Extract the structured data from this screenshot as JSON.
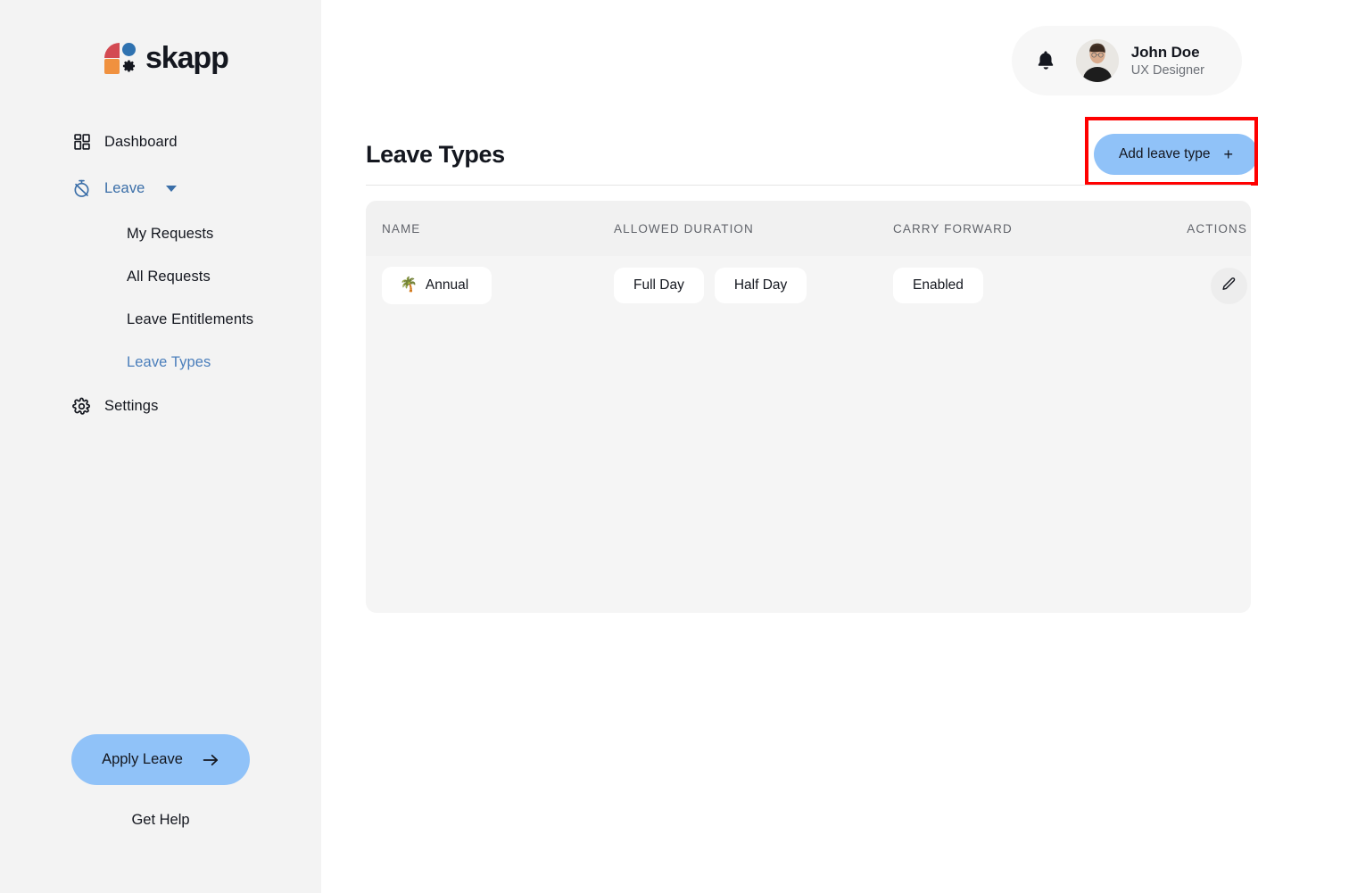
{
  "brand": {
    "name": "skapp",
    "logo_colors": {
      "red": "#d34a52",
      "orange": "#f0913f",
      "blue": "#2f72b0",
      "gear": "#14171f"
    }
  },
  "theme": {
    "accent_blue": "#90c2f8",
    "active_nav_blue": "#4a7ebb",
    "sidebar_bg": "#f3f3f3",
    "table_bg": "#f5f5f5",
    "table_header_bg": "#f1f1f1",
    "highlight_red": "#ff0000"
  },
  "sidebar": {
    "items": [
      {
        "label": "Dashboard",
        "icon": "grid-icon",
        "active": false
      },
      {
        "label": "Leave",
        "icon": "stopwatch-off-icon",
        "active": true,
        "expanded": true
      },
      {
        "label": "Settings",
        "icon": "gear-icon",
        "active": false
      }
    ],
    "leave_subitems": [
      {
        "label": "My Requests",
        "active": false
      },
      {
        "label": "All Requests",
        "active": false
      },
      {
        "label": "Leave Entitlements",
        "active": false
      },
      {
        "label": "Leave Types",
        "active": true
      }
    ],
    "apply_leave_label": "Apply Leave",
    "get_help_label": "Get Help"
  },
  "header": {
    "notification_icon": "bell-icon",
    "user": {
      "name": "John Doe",
      "role": "UX Designer",
      "avatar_alt": "avatar"
    }
  },
  "main": {
    "page_title": "Leave Types",
    "add_button_label": "Add leave type",
    "add_button_glyph": "+"
  },
  "table": {
    "columns": [
      "NAME",
      "ALLOWED DURATION",
      "CARRY FORWARD",
      "ACTIONS"
    ],
    "rows": [
      {
        "emoji": "🌴",
        "name": "Annual",
        "durations": [
          "Full Day",
          "Half Day"
        ],
        "carry_forward": "Enabled",
        "action_icon": "pencil-icon"
      }
    ]
  }
}
